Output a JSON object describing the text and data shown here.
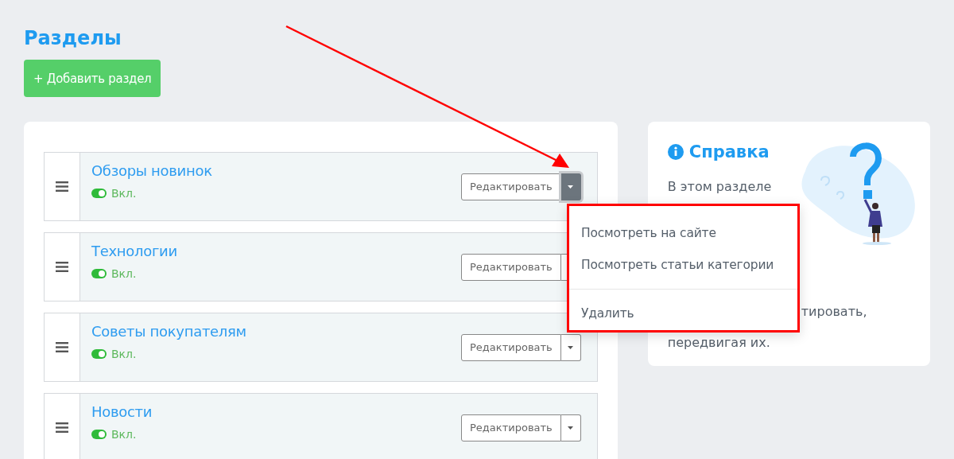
{
  "page_title": "Разделы",
  "add_button": {
    "icon": "+",
    "label": "Добавить раздел"
  },
  "sections": [
    {
      "name": "Обзоры новинок",
      "enabled": true,
      "status": "Вкл.",
      "edit_label": "Редактировать",
      "menu_open": true
    },
    {
      "name": "Технологии",
      "enabled": true,
      "status": "Вкл.",
      "edit_label": "Редактировать",
      "menu_open": false
    },
    {
      "name": "Советы покупателям",
      "enabled": true,
      "status": "Вкл.",
      "edit_label": "Редактировать",
      "menu_open": false
    },
    {
      "name": "Новости",
      "enabled": true,
      "status": "Вкл.",
      "edit_label": "Редактировать",
      "menu_open": false
    }
  ],
  "dropdown_menu": {
    "items": [
      "Посмотреть на сайте",
      "Посмотреть статьи категории"
    ],
    "footer_items": [
      "Удалить"
    ]
  },
  "help": {
    "title": "Справка",
    "lines": [
      "В этом разделе",
      "тировать,",
      "передвигая их."
    ]
  }
}
